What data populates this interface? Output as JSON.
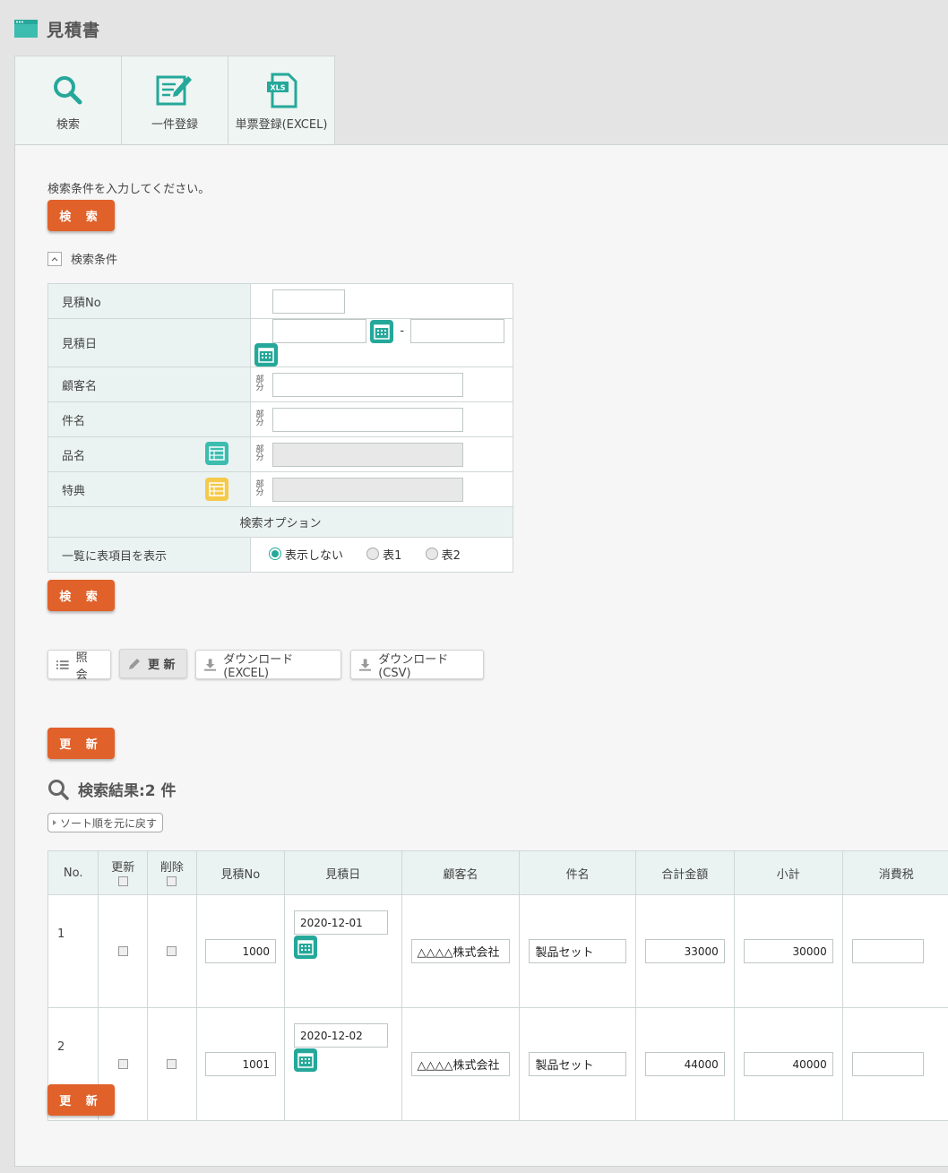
{
  "page": {
    "title": "見積書"
  },
  "toolbar": [
    {
      "label": "検索",
      "icon": "search-icon"
    },
    {
      "label": "一件登録",
      "icon": "edit-form-icon"
    },
    {
      "label": "単票登録(EXCEL)",
      "icon": "xls-file-icon"
    }
  ],
  "search": {
    "instruction": "検索条件を入力してください。",
    "button_label": "検 索",
    "toggle_label": "検索条件",
    "fields": {
      "estimate_no": "見積No",
      "estimate_date": "見積日",
      "date_separator": "-",
      "customer": "顧客名",
      "subject": "件名",
      "product": "品名",
      "bonus": "特典",
      "partial_marker": "部分"
    },
    "options_header": "検索オプション",
    "display_label": "一覧に表項目を表示",
    "radio_options": [
      "表示しない",
      "表1",
      "表2"
    ],
    "radio_selected": "表示しない"
  },
  "modes": {
    "view": "照 会",
    "update": "更 新",
    "download_excel": "ダウンロード(EXCEL)",
    "download_csv": "ダウンロード(CSV)"
  },
  "update_button": "更 新",
  "results": {
    "title": "検索結果:2 件",
    "sort_reset": "ソート順を元に戻す",
    "columns": [
      "No.",
      "更新",
      "削除",
      "見積No",
      "見積日",
      "顧客名",
      "件名",
      "合計金額",
      "小計",
      "消費税"
    ],
    "rows": [
      {
        "no": "1",
        "estimate_no": "1000",
        "date": "2020-12-01",
        "customer": "△△△△株式会社",
        "subject": "製品セット",
        "total": "33000",
        "subtotal": "30000"
      },
      {
        "no": "2",
        "estimate_no": "1001",
        "date": "2020-12-02",
        "customer": "△△△△株式会社",
        "subject": "製品セット",
        "total": "44000",
        "subtotal": "40000"
      }
    ]
  },
  "colors": {
    "accent": "#25a89a",
    "button": "#e0612a",
    "label_bg": "#eaf3f1"
  }
}
